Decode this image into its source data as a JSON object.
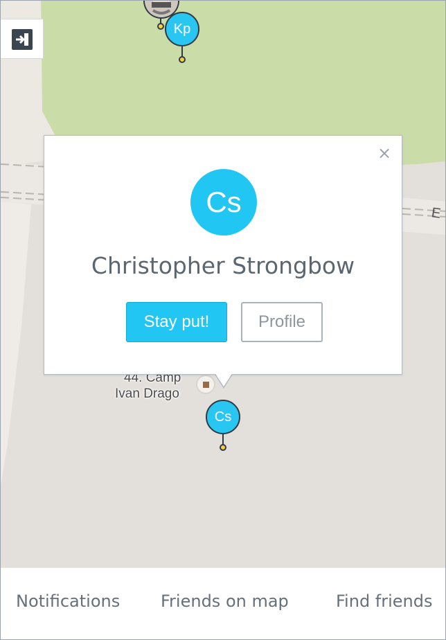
{
  "map": {
    "exit_icon": "exit-icon",
    "pins": [
      {
        "initials": "Kp",
        "color": "#2ac6f2"
      },
      {
        "initials": "Cs",
        "color": "#2ac6f2"
      }
    ],
    "place_label_line1": "44. Camp",
    "place_label_line2": "Ivan Drago",
    "road_letter": "E"
  },
  "popup": {
    "close_icon": "×",
    "avatar_initials": "Cs",
    "name": "Christopher Strongbow",
    "primary_label": "Stay put!",
    "secondary_label": "Profile",
    "accent_color": "#21c6f2"
  },
  "nav": {
    "items": [
      {
        "label": "Notifications"
      },
      {
        "label": "Friends on map"
      },
      {
        "label": "Find friends"
      }
    ]
  }
}
